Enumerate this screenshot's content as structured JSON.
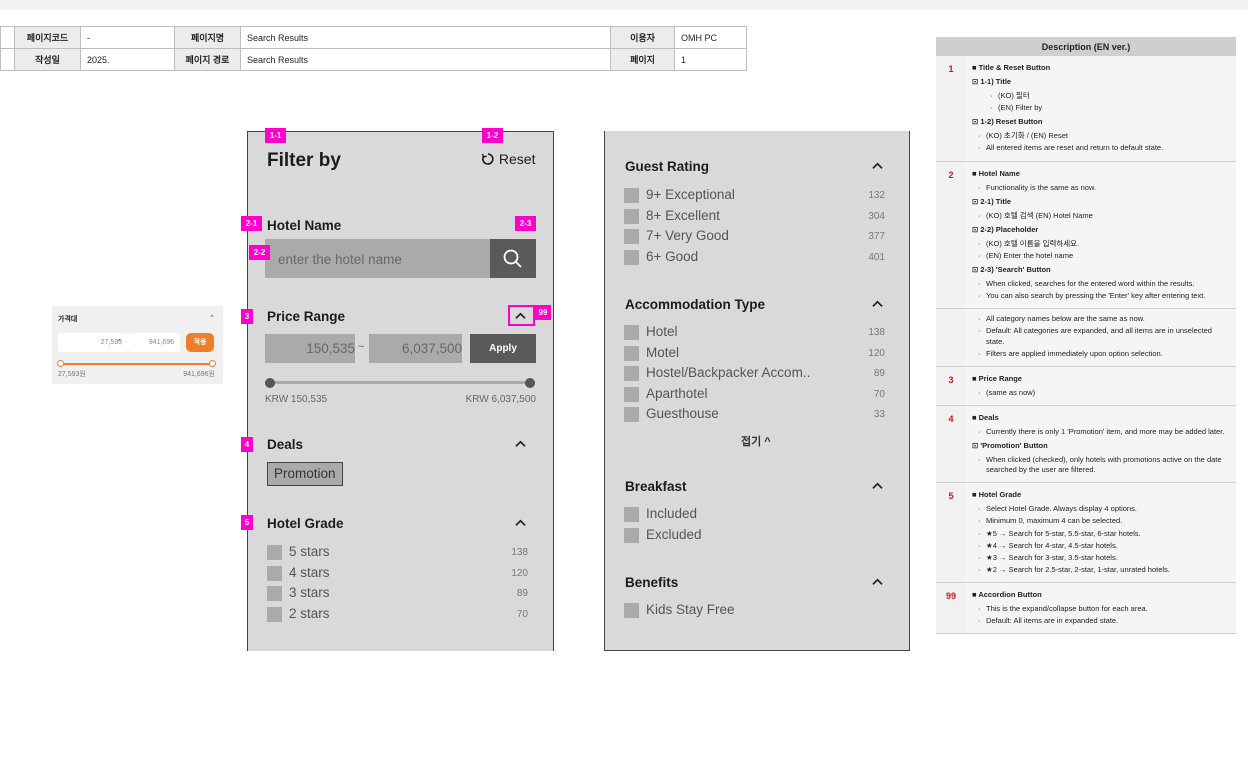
{
  "header": {
    "page_code_label": "페이지코드",
    "page_code": "-",
    "page_name_label": "페이지명",
    "page_name": "Search Results",
    "user_label": "이용자",
    "user": "OMH PC",
    "date_label": "작성일",
    "date": "2025.",
    "path_label": "페이지 경로",
    "path": "Search Results",
    "page_label": "페이지",
    "page": "1"
  },
  "mini_widget": {
    "title": "가격대",
    "min": "27,593",
    "sep": "-",
    "max": "941,696",
    "apply": "적용",
    "min_label": "27,593원",
    "max_label": "941,696원",
    "accent": "#f07d2a"
  },
  "filter": {
    "title": "Filter by",
    "reset": "Reset",
    "hotel_name": {
      "title": "Hotel Name",
      "placeholder": "enter the hotel name"
    },
    "price": {
      "title": "Price Range",
      "min": "150,535",
      "sep": "~",
      "max": "6,037,500",
      "apply": "Apply",
      "min_label": "KRW 150,535",
      "max_label": "KRW 6,037,500"
    },
    "deals": {
      "title": "Deals",
      "promotion": "Promotion"
    },
    "grade": {
      "title": "Hotel Grade",
      "options": [
        {
          "label": "5 stars",
          "count": "138"
        },
        {
          "label": "4 stars",
          "count": "120"
        },
        {
          "label": "3 stars",
          "count": "89"
        },
        {
          "label": "2 stars",
          "count": "70"
        }
      ]
    },
    "guest_rating": {
      "title": "Guest Rating",
      "options": [
        {
          "label": "9+ Exceptional",
          "count": "132"
        },
        {
          "label": "8+ Excellent",
          "count": "304"
        },
        {
          "label": "7+ Very Good",
          "count": "377"
        },
        {
          "label": "6+ Good",
          "count": "401"
        }
      ]
    },
    "accommodation": {
      "title": "Accommodation Type",
      "options": [
        {
          "label": "Hotel",
          "count": "138"
        },
        {
          "label": "Motel",
          "count": "120"
        },
        {
          "label": "Hostel/Backpacker Accom..",
          "count": "89"
        },
        {
          "label": "Aparthotel",
          "count": "70"
        },
        {
          "label": "Guesthouse",
          "count": "33"
        }
      ],
      "collapse": "접기 ^"
    },
    "breakfast": {
      "title": "Breakfast",
      "options": [
        {
          "label": "Included"
        },
        {
          "label": "Excluded"
        }
      ]
    },
    "benefits": {
      "title": "Benefits",
      "options": [
        {
          "label": "Kids Stay Free"
        }
      ]
    }
  },
  "tags": [
    "1-1",
    "1-2",
    "2-1",
    "2-2",
    "2-3",
    "3",
    "4",
    "5",
    "99"
  ],
  "colors": {
    "tag": "#ff00cc",
    "panel": "#d9d9d9",
    "dark_button": "#5a5a5a",
    "desc_number": "#d01818"
  },
  "description": {
    "title": "Description (EN ver.)",
    "rows": [
      {
        "no": "1",
        "heading": "■ Title & Reset Button",
        "parts": [
          {
            "sub": "⊡ 1-1) Title",
            "deep": true,
            "items": [
              "(KO) 필터",
              "(EN) Filter by"
            ]
          },
          {
            "sub": "⊡ 1-2) Reset Button",
            "items": [
              "(KO) 초기화 / (EN) Reset",
              "All entered items are reset and return to default state."
            ]
          }
        ]
      },
      {
        "no": "2",
        "heading": "■ Hotel Name",
        "parts": [
          {
            "sub": "",
            "items": [
              "Functionality is the same as now."
            ]
          },
          {
            "sub": "⊡ 2-1) Title",
            "items": [
              "(KO) 호텔 검색 (EN) Hotel Name"
            ]
          },
          {
            "sub": "⊡ 2-2) Placeholder",
            "items": [
              "(KO) 호텔 이름을 입력하세요.",
              "(EN) Enter the hotel name"
            ]
          },
          {
            "sub": "⊡ 2-3) 'Search' Button",
            "items": [
              "When clicked, searches for the entered word within the results.",
              "You can also search by pressing the 'Enter' key after entering text."
            ]
          }
        ]
      },
      {
        "no": "",
        "heading": "",
        "parts": [
          {
            "sub": "",
            "items": [
              "All category names below are the same as now.",
              "Default: All categories are expanded, and all items are in unselected state.",
              "Filters are applied immediately upon option selection."
            ]
          }
        ]
      },
      {
        "no": "3",
        "heading": "■ Price Range",
        "parts": [
          {
            "sub": "",
            "items": [
              "(same as now)"
            ]
          }
        ]
      },
      {
        "no": "4",
        "heading": "■ Deals",
        "parts": [
          {
            "sub": "",
            "items": [
              "Currently there is only 1 'Promotion' item, and more may be added later."
            ]
          },
          {
            "sub": "⊡ 'Promotion' Button",
            "items": [
              "When clicked (checked), only hotels with promotions active on the date searched by the user are filtered."
            ]
          }
        ]
      },
      {
        "no": "5",
        "heading": "■ Hotel Grade",
        "parts": [
          {
            "sub": "",
            "items": [
              "Select Hotel Grade. Always display 4 options.",
              "Minimum 0, maximum 4 can be selected.",
              "★5 → Search for 5-star, 5.5-star, 6-star hotels.",
              "★4 → Search for 4-star, 4.5-star hotels.",
              "★3 → Search for 3-star, 3.5-star hotels.",
              "★2 → Search for 2.5-star, 2-star, 1-star, unrated hotels."
            ]
          }
        ]
      },
      {
        "no": "99",
        "heading": "■ Accordion Button",
        "parts": [
          {
            "sub": "",
            "items": [
              "This is the expand/collapse button for each area.",
              "Default: All items are in expanded state."
            ]
          }
        ]
      }
    ]
  }
}
